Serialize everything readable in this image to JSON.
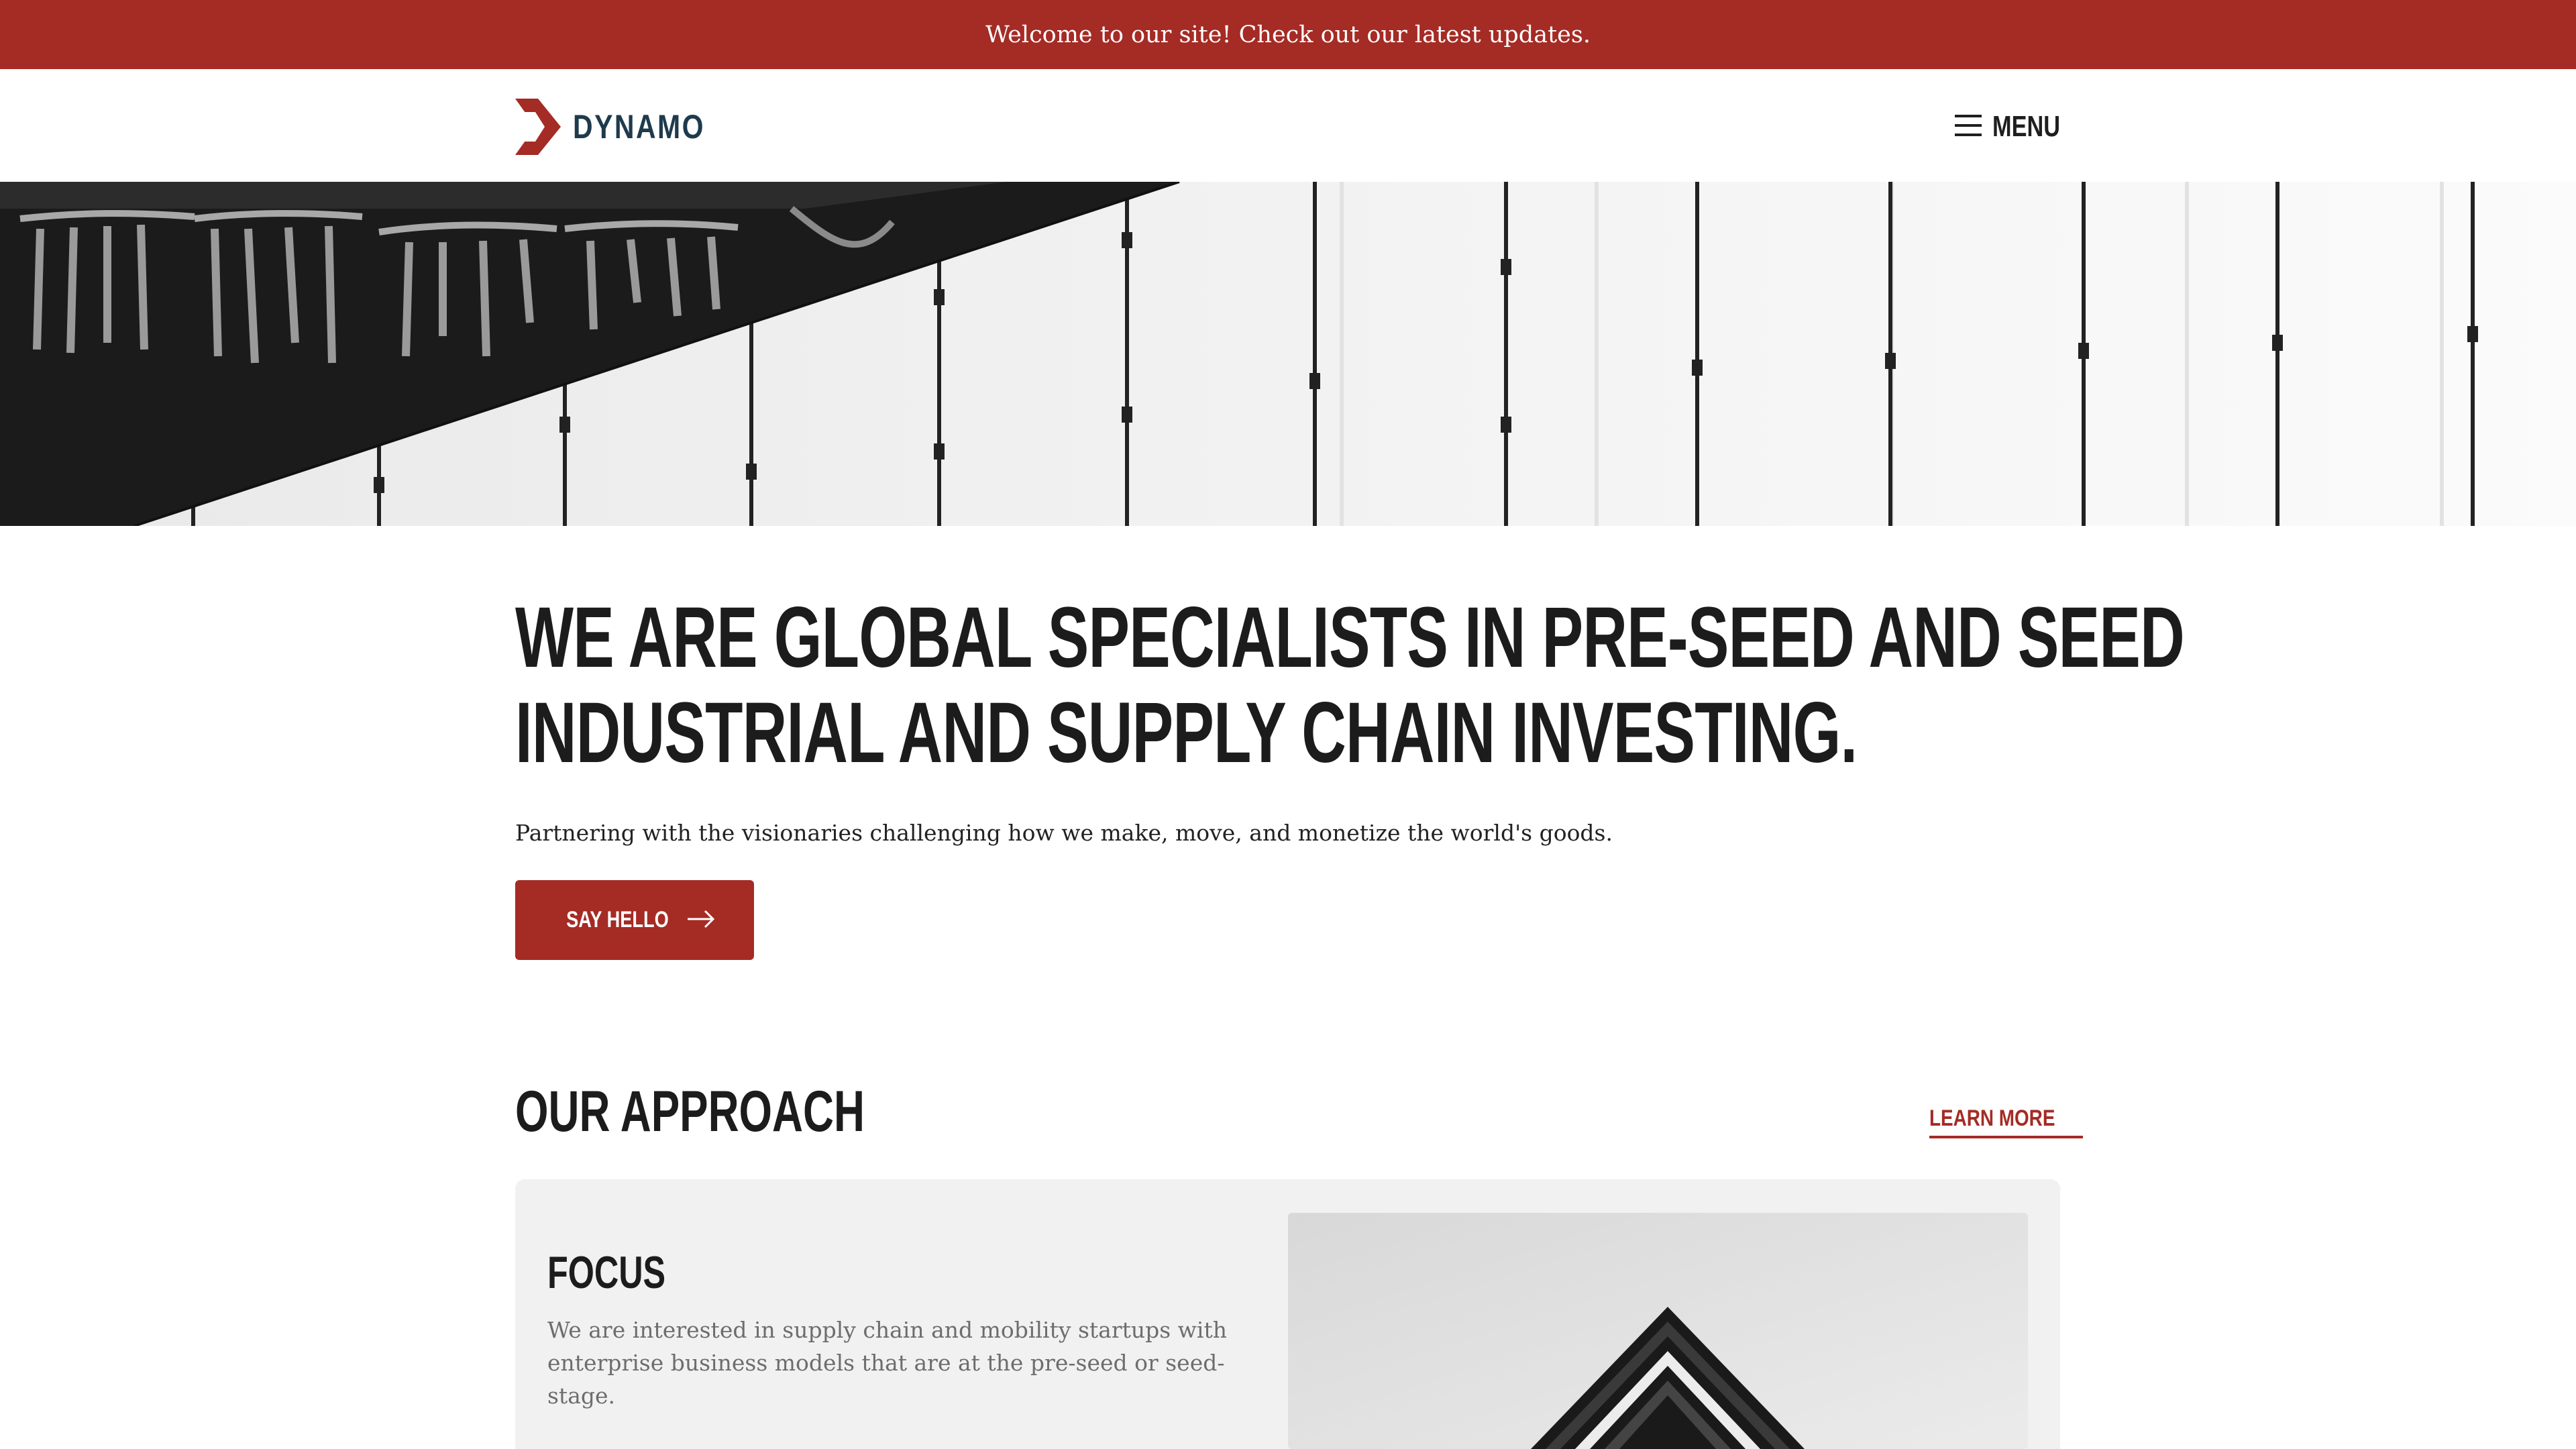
{
  "announcement": {
    "text": "Welcome to our site! Check out our latest updates."
  },
  "header": {
    "logo_text": "DYNAMO",
    "menu_label": "MENU",
    "brand_color": "#a52b25",
    "logo_text_color": "#1f3a4d"
  },
  "hero": {
    "headline_line1": "We are global specialists in pre-seed and seed",
    "headline_line2": "industrial and supply chain investing.",
    "subtext": "Partnering with the visionaries challenging how we make, move, and monetize the world's goods.",
    "cta_label": "SAY HELLO"
  },
  "approach": {
    "title": "OUR APPROACH",
    "learn_more": "LEARN MORE",
    "card": {
      "title": "FOCUS",
      "text": "We are interested in supply chain and mobility startups with enterprise business models that are at the pre-seed or seed-stage."
    }
  },
  "icons": {
    "logo": "dynamo-chevron-logo-icon",
    "menu": "hamburger-menu-icon",
    "cta": "arrow-right-icon"
  }
}
